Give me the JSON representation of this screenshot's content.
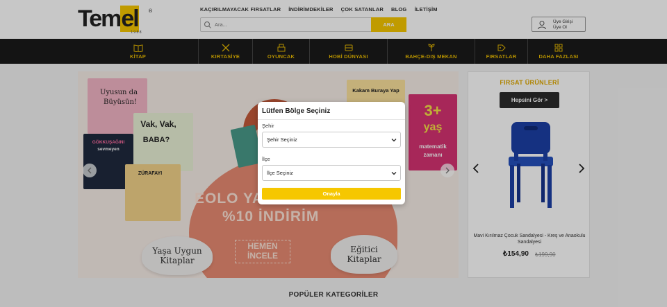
{
  "brand": {
    "name_pre": "T",
    "name_mid": "em",
    "name_el": "el",
    "year": "1988",
    "registered": "®"
  },
  "topnav": [
    "KAÇIRILMAYACAK FIRSATLAR",
    "İNDİRİMDEKİLER",
    "ÇOK SATANLAR",
    "BLOG",
    "İLETİŞİM"
  ],
  "search": {
    "placeholder": "Ara...",
    "button": "ARA"
  },
  "account": {
    "line1": "Üye Girişi",
    "line2": "Üye Ol"
  },
  "categories": [
    "KİTAP",
    "KIRTASİYE",
    "OYUNCAK",
    "HOBİ DÜNYASI",
    "BAHÇE-DIŞ MEKAN",
    "FIRSATLAR",
    "DAHA FAZLASI"
  ],
  "hero": {
    "line1": "EOLO YA",
    "line2": "%10 İNDİRİM",
    "cta_line1": "HEMEN",
    "cta_line2": "İNCELE",
    "cloud_left_1": "Yaşa Uygun",
    "cloud_left_2": "Kitaplar",
    "cloud_right_1": "Eğitici",
    "cloud_right_2": "Kitaplar",
    "books": {
      "b1_a": "Uyusun da",
      "b1_b": "Büyüsün!",
      "b2_a": "Vak, Vak,",
      "b2_b": "BABA?",
      "b3_a": "GÖKKUŞAĞINI",
      "b3_b": "sevmeyen",
      "b4_a": "ZÜRAFAYI",
      "b5_a": "Kakam Buraya Yap",
      "b6_a": "3+",
      "b6_b": "yaş",
      "b6_c": "matematik",
      "b6_d": "zamanı"
    }
  },
  "deals": {
    "title": "FIRSAT ÜRÜNLERİ",
    "button": "Hepsini Gör >",
    "product_name": "Mavi Kırılmaz Çocuk Sandalyesi - Kreş ve Anaokulu Sandalyesi",
    "price": "₺154,90",
    "old_price": "₺199,90"
  },
  "popular_title": "POPÜLER KATEGORİLER",
  "modal": {
    "title": "Lütfen Bölge Seçiniz",
    "city_label": "Şehir",
    "city_value": "Şehir Seçiniz",
    "district_label": "İlçe",
    "district_value": "İlçe Seçiniz",
    "confirm": "Onayla"
  },
  "colors": {
    "accent": "#f6c700",
    "catbar": "#1a1a1a",
    "cat_text": "#e6b800",
    "deals_title": "#e1a900",
    "hero_blob": "#e88b72"
  }
}
